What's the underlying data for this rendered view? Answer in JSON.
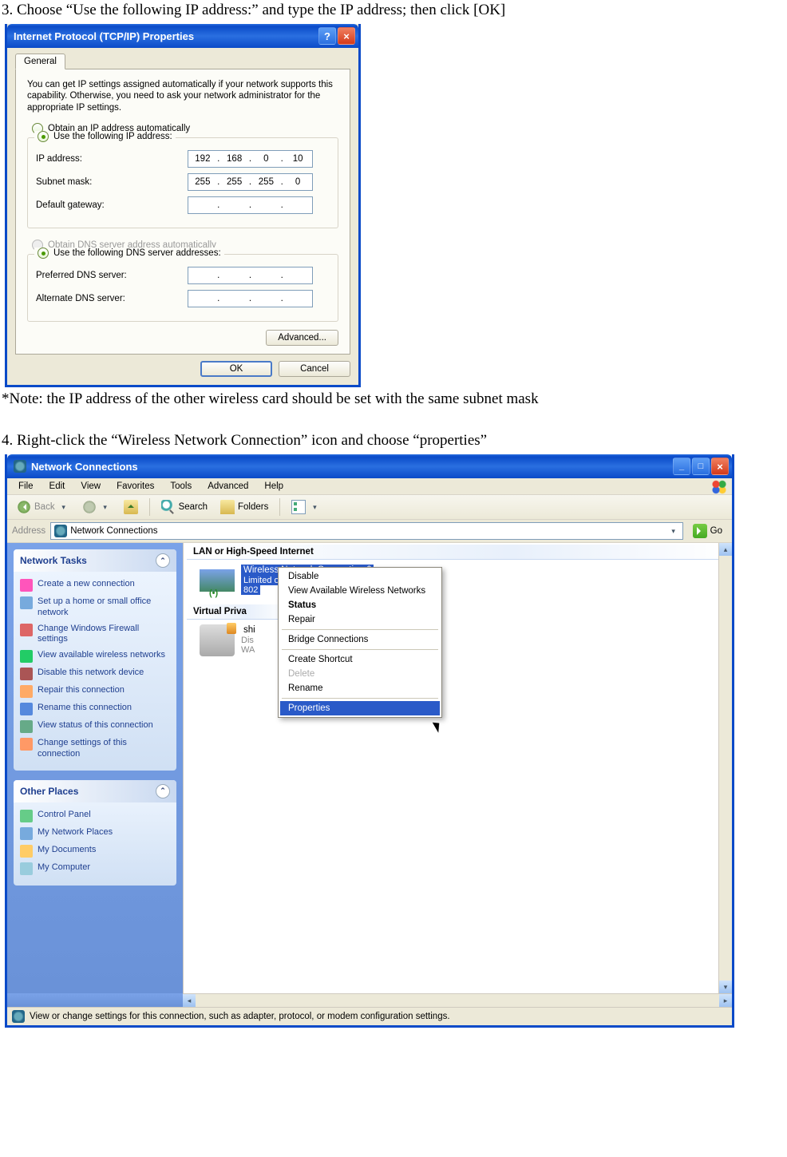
{
  "doc": {
    "step3": "3. Choose “Use the following IP address:” and type the IP address; then click [OK]",
    "note": "*Note: the IP address of the other wireless card should be set with the same subnet mask",
    "step4": "4. Right-click the “Wireless Network Connection” icon and choose “properties”"
  },
  "dialog1": {
    "title": "Internet Protocol (TCP/IP) Properties",
    "tab": "General",
    "description": "You can get IP settings assigned automatically if your network supports this capability. Otherwise, you need to ask your network administrator for the appropriate IP settings.",
    "radio_auto_ip": "Obtain an IP address automatically",
    "radio_manual_ip": "Use the following IP address:",
    "labels": {
      "ip": "IP address:",
      "subnet": "Subnet mask:",
      "gateway": "Default gateway:",
      "pref_dns": "Preferred DNS server:",
      "alt_dns": "Alternate DNS server:"
    },
    "values": {
      "ip": [
        "192",
        "168",
        "0",
        "10"
      ],
      "subnet": [
        "255",
        "255",
        "255",
        "0"
      ],
      "gateway": [
        "",
        "",
        "",
        ""
      ],
      "pref_dns": [
        "",
        "",
        "",
        ""
      ],
      "alt_dns": [
        "",
        "",
        "",
        ""
      ]
    },
    "radio_auto_dns": "Obtain DNS server address automatically",
    "radio_manual_dns": "Use the following DNS server addresses:",
    "buttons": {
      "advanced": "Advanced...",
      "ok": "OK",
      "cancel": "Cancel"
    }
  },
  "window2": {
    "title": "Network Connections",
    "menus": [
      "File",
      "Edit",
      "View",
      "Favorites",
      "Tools",
      "Advanced",
      "Help"
    ],
    "toolbar": {
      "back": "Back",
      "search": "Search",
      "folders": "Folders"
    },
    "address": {
      "label": "Address",
      "value": "Network Connections",
      "go": "Go"
    },
    "sidebar": {
      "tasks_title": "Network Tasks",
      "tasks": [
        "Create a new connection",
        "Set up a home or small office network",
        "Change Windows Firewall settings",
        "View available wireless networks",
        "Disable this network device",
        "Repair this connection",
        "Rename this connection",
        "View status of this connection",
        "Change settings of this connection"
      ],
      "places_title": "Other Places",
      "places": [
        "Control Panel",
        "My Network Places",
        "My Documents",
        "My Computer"
      ]
    },
    "content": {
      "cat1": "LAN or High-Speed Internet",
      "wireless": {
        "name": "Wireless Network Connection 6",
        "status": "Limited or no connectivity   Fi...",
        "device_prefix": "802"
      },
      "cat2": "Virtual Priva",
      "vpn": {
        "name_prefix": "shi",
        "status_prefix": "Dis",
        "device_prefix": "WA"
      }
    },
    "context_menu": {
      "items": [
        {
          "label": "Disable"
        },
        {
          "label": "View Available Wireless Networks"
        },
        {
          "label": "Status",
          "bold": true
        },
        {
          "label": "Repair"
        },
        {
          "sep": true
        },
        {
          "label": "Bridge Connections"
        },
        {
          "sep": true
        },
        {
          "label": "Create Shortcut"
        },
        {
          "label": "Delete",
          "disabled": true
        },
        {
          "label": "Rename"
        },
        {
          "sep": true
        },
        {
          "label": "Properties",
          "hover": true
        }
      ]
    },
    "statusbar": "View or change settings for this connection, such as adapter, protocol, or modem configuration settings."
  }
}
